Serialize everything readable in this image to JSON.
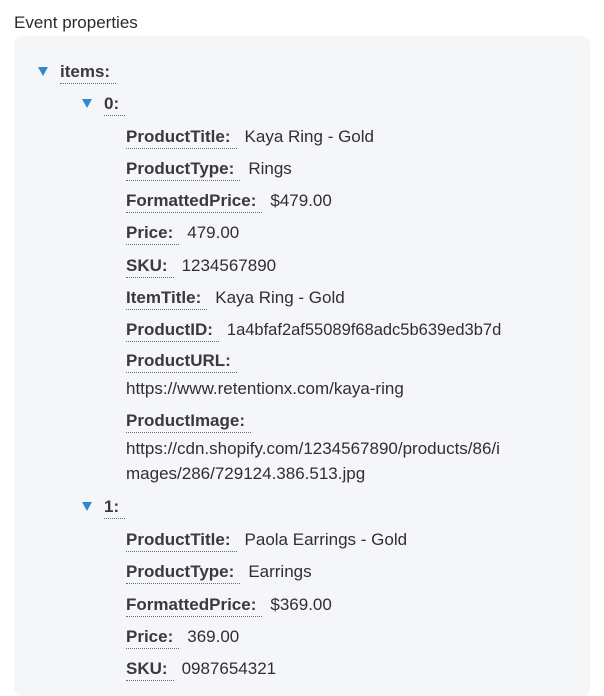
{
  "section_title": "Event properties",
  "tree": {
    "items_key": "items:",
    "item0": {
      "key": "0:",
      "ProductTitle": {
        "key": "ProductTitle:",
        "value": "Kaya Ring - Gold"
      },
      "ProductType": {
        "key": "ProductType:",
        "value": "Rings"
      },
      "FormattedPrice": {
        "key": "FormattedPrice:",
        "value": "$479.00"
      },
      "Price": {
        "key": "Price:",
        "value": "479.00"
      },
      "SKU": {
        "key": "SKU:",
        "value": "1234567890"
      },
      "ItemTitle": {
        "key": "ItemTitle:",
        "value": "Kaya Ring - Gold"
      },
      "ProductID": {
        "key": "ProductID:",
        "value": "1a4bfaf2af55089f68adc5b639ed3b7d"
      },
      "ProductURL": {
        "key": "ProductURL:",
        "value": "https://www.retentionx.com/kaya-ring"
      },
      "ProductImage": {
        "key": "ProductImage:",
        "value_line1": "https://cdn.shopify.com/1234567890/products/86/i",
        "value_line2": "mages/286/729124.386.513.jpg"
      }
    },
    "item1": {
      "key": "1:",
      "ProductTitle": {
        "key": "ProductTitle:",
        "value": "Paola Earrings - Gold"
      },
      "ProductType": {
        "key": "ProductType:",
        "value": "Earrings"
      },
      "FormattedPrice": {
        "key": "FormattedPrice:",
        "value": "$369.00"
      },
      "Price": {
        "key": "Price:",
        "value": "369.00"
      },
      "SKU": {
        "key": "SKU:",
        "value": "0987654321"
      }
    }
  },
  "icons": {
    "toggle": "caret-down-icon"
  },
  "colors": {
    "toggle": "#2a8ad8",
    "panel_bg": "#f5f6f8"
  }
}
